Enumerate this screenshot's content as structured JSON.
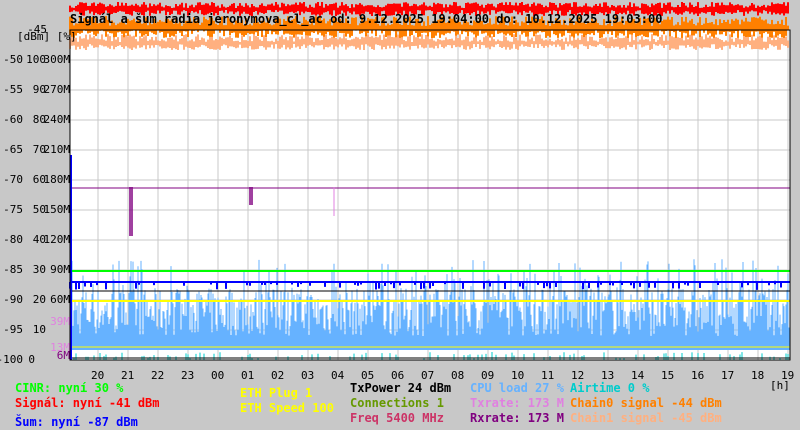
{
  "chart_data": {
    "type": "line",
    "title": "Signál a šum radia jeronymova_cl_ac od: 9.12.2025 19:04:00 do: 10.12.2025 19:03:00",
    "y_unit_label": "[dBm] [%]",
    "x_unit_label": "[h]",
    "x_ticks": [
      "20",
      "21",
      "22",
      "23",
      "00",
      "01",
      "02",
      "03",
      "04",
      "05",
      "06",
      "07",
      "08",
      "09",
      "10",
      "11",
      "12",
      "13",
      "14",
      "15",
      "16",
      "17",
      "18",
      "19"
    ],
    "y_ticks": [
      {
        "dbm": "-45",
        "pct": "",
        "rate": ""
      },
      {
        "dbm": "-50",
        "pct": "100",
        "rate": "300M"
      },
      {
        "dbm": "-55",
        "pct": "90",
        "rate": "270M"
      },
      {
        "dbm": "-60",
        "pct": "80",
        "rate": "240M"
      },
      {
        "dbm": "-65",
        "pct": "70",
        "rate": "210M"
      },
      {
        "dbm": "-70",
        "pct": "60",
        "rate": "180M"
      },
      {
        "dbm": "-75",
        "pct": "50",
        "rate": "150M"
      },
      {
        "dbm": "-80",
        "pct": "40",
        "rate": "120M"
      },
      {
        "dbm": "-85",
        "pct": "30",
        "rate": "90M"
      },
      {
        "dbm": "-90",
        "pct": "20",
        "rate": "60M"
      },
      {
        "dbm": "-95",
        "pct": "10",
        "rate": ""
      },
      {
        "dbm": "-100",
        "pct": "0",
        "rate": ""
      }
    ],
    "extra_rate_ticks": [
      {
        "label": "39M",
        "color": "#e080e0"
      },
      {
        "label": "13M",
        "color": "#e080e0"
      },
      {
        "label": "6M",
        "color": "#800080"
      }
    ],
    "ylim": [
      -100,
      -45
    ],
    "grid": true,
    "series": [
      {
        "name": "Signal",
        "color": "#ff0000",
        "approx_level_dbm": -42
      },
      {
        "name": "Chain0 signal",
        "color": "#ff8000",
        "approx_level_dbm": -44
      },
      {
        "name": "Chain1 signal",
        "color": "#ffb080",
        "approx_level_dbm": -45
      },
      {
        "name": "CINR",
        "color": "#00ff00",
        "approx_level_pct": 30
      },
      {
        "name": "Noise",
        "color": "#0000ff",
        "approx_level_dbm": -87
      },
      {
        "name": "TxPower",
        "color": "#000000",
        "approx_level_dbm": -87.5
      },
      {
        "name": "ETH Speed",
        "color": "#ffff00",
        "approx_level_pct": 20
      },
      {
        "name": "CPU load",
        "color": "#66b2ff",
        "approx_range_pct": [
          0,
          30
        ]
      },
      {
        "name": "Airtime",
        "color": "#00cccc",
        "approx_level_pct": 0
      },
      {
        "name": "Rxrate",
        "color": "#800080",
        "approx_level_mbit": 173
      },
      {
        "name": "Txrate",
        "color": "#e080e0",
        "approx_level_mbit": 173
      }
    ]
  },
  "legend": {
    "cinr": "CINR: nyní 30 %",
    "signal": "Signál: nyní -41 dBm",
    "noise": "Šum: nyní -87 dBm",
    "eth_plug": "ETH Plug 1",
    "eth_speed": "ETH Speed 100",
    "txpower": "TxPower 24 dBm",
    "connections": "Connections 1",
    "freq": "Freq 5400 MHz",
    "cpu": "CPU load 27 %",
    "txrate": "Txrate: 173 M",
    "rxrate": "Rxrate: 173 M",
    "airtime": "Airtime 0 %",
    "chain0": "Chain0 signal -44 dBm",
    "chain1": "Chain1 signal -45 dBm"
  },
  "colors": {
    "cinr": "#00ff00",
    "signal": "#ff0000",
    "noise": "#0000ff",
    "eth": "#ffff00",
    "txpower": "#000000",
    "connections": "#669900",
    "freq": "#cc3366",
    "cpu": "#66b2ff",
    "txrate": "#e080e0",
    "rxrate": "#800080",
    "airtime": "#00cccc",
    "chain0": "#ff8000",
    "chain1": "#ffb080"
  }
}
